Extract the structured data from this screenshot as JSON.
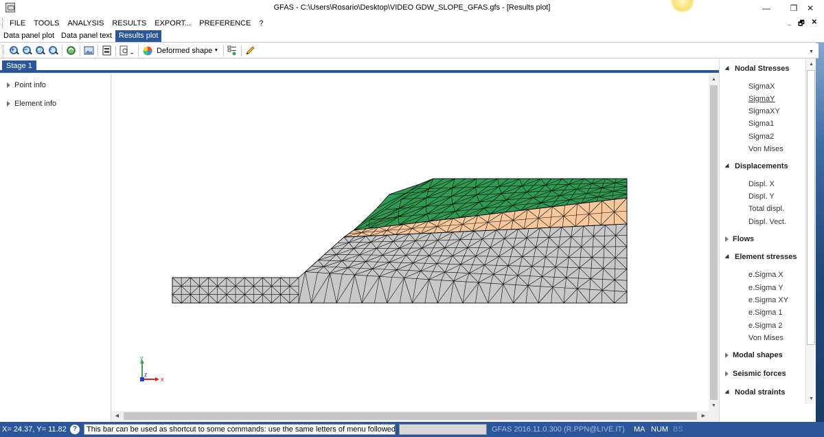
{
  "window": {
    "title": "GFAS  -  C:\\Users\\Rosario\\Desktop\\VIDEO GDW_SLOPE_GFAS.gfs - [Results plot]",
    "minimize": "—",
    "restore": "❐",
    "close": "✕"
  },
  "menu": {
    "items": [
      "FILE",
      "TOOLS",
      "ANALYSIS",
      "RESULTS",
      "EXPORT...",
      "PREFERENCE",
      "?"
    ],
    "mdi_minimize": "_",
    "mdi_restore": "🗗",
    "mdi_close": "✕"
  },
  "panel_tabs": [
    "Data panel plot",
    "Data panel text",
    "Results plot"
  ],
  "toolbar": {
    "display_mode": "Deformed shape",
    "icons": [
      "zoom-in-icon",
      "zoom-out-icon",
      "zoom-window-icon",
      "zoom-extents-icon",
      "refresh-icon",
      "image-icon",
      "export-icon",
      "print-preview-icon",
      "color-palette-icon",
      "checklist-icon",
      "pencil-icon"
    ]
  },
  "stage_tab": "Stage 1",
  "left_panel": {
    "items": [
      "Point info",
      "Element info"
    ]
  },
  "axes": {
    "y": "y",
    "z": "z",
    "x": "x"
  },
  "right_panel": {
    "groups": [
      {
        "title": "Nodal Stresses",
        "expanded": true,
        "items": [
          "SigmaX",
          "SigmaY",
          "SigmaXY",
          "Sigma1",
          "Sigma2",
          "Von Mises"
        ]
      },
      {
        "title": "Displacements",
        "expanded": true,
        "items": [
          "Displ. X",
          "Displ. Y",
          "Total displ.",
          "Displ. Vect."
        ]
      },
      {
        "title": "Flows",
        "expanded": false,
        "items": []
      },
      {
        "title": "Element stresses",
        "expanded": true,
        "items": [
          "e.Sigma X",
          "e.Sigma Y",
          "e.Sigma XY",
          "e.Sigma 1",
          "e.Sigma 2",
          "Von Mises"
        ]
      },
      {
        "title": "Modal shapes",
        "expanded": false,
        "items": []
      },
      {
        "title": "Seismic forces",
        "expanded": false,
        "items": []
      },
      {
        "title": "Nodal straints",
        "expanded": true,
        "items": []
      }
    ]
  },
  "status": {
    "coords": "X= 24.37, Y= 11.82",
    "help": "?",
    "command_bar": "This bar can be used as shortcut to some commands: use the same letters of menu followed by enter.",
    "version": "GFAS  2016.11.0.300  (R.PPN@LIVE.IT)",
    "ma": "MA",
    "num": "NUM",
    "bs": "BS"
  },
  "mesh_colors": {
    "top_layer": "#2f9a52",
    "middle_layer": "#f8c89c",
    "base_layer": "#c8c8c8",
    "lines": "#000000"
  }
}
